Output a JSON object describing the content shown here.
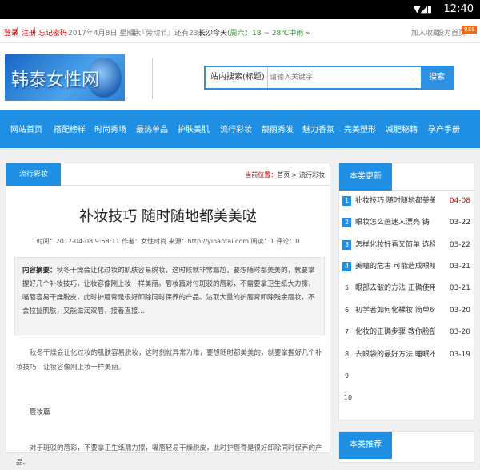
{
  "status_bar": {
    "time": "12:40",
    "signal": "▼◢▮"
  },
  "topbar": {
    "login": "登录",
    "sep1": " / ",
    "register": "注册",
    "sep2": " / ",
    "forgot": "忘记密码",
    "date": "2017年4月8日 星期六",
    "countdown": "距『劳动节』还有23天",
    "city": "长沙",
    "today": "今天",
    "weekday": "(周六)",
    "temp": "：18 ~ 28℃中雨 »",
    "favorite": "加入收藏",
    "homepage": "设为首页",
    "rss": "RSS"
  },
  "header": {
    "logo_text": "韩泰女性网",
    "search_scope": "站内搜索(标题)",
    "search_placeholder": "请输入关键字",
    "search_button": "搜索"
  },
  "nav": [
    "网站首页",
    "搭配榜样",
    "时尚秀场",
    "最热单品",
    "护肤美肌",
    "流行彩妆",
    "靓丽秀发",
    "魅力香氛",
    "完美塑形",
    "减肥秘籍",
    "孕产手册"
  ],
  "article": {
    "tab": "流行彩妆",
    "breadcrumb_label": "当前位置：",
    "breadcrumb_path": "首页 > 流行彩妆",
    "title": "补妆技巧 随时随地都美美哒",
    "meta": "时间：2017-04-08 9:58:11   作者：女性时尚   来源：http://yihantai.com   阅读：1   评论：0",
    "summary_label": "内容摘要：",
    "summary_text": "秋冬干燥会让化过妆的肌肤容易脱妆，这时候就非常尴尬，要想随时都美美的，就要掌握好几个补妆技巧，让妆容像刚上妆一样美丽。唇妆篇对付斑驳的唇彩，不需要拿卫生纸大力擦，嘴唇容易干燥脱皮，此时护唇膏是很好卸除同时保养的产品。沾取大量的护唇膏卸除残余唇妆，不会拉扯肌肤，又能滋润双唇，接着直接...",
    "para1": "秋冬干燥会让化过妆的肌肤容易脱妆，这时刻就异常为难，要想随时都美美的，就要掌握好几个补妆技巧，让妆容像刚上妆一样美丽。",
    "section": "唇妆篇",
    "para2": "对于斑驳的唇彩，不要拿卫生纸鼎力擦，嘴唇轻易干燥脱皮，此时护唇膏是很好卸除同时保养的产品。"
  },
  "sidebar": {
    "title": "本类更新",
    "items": [
      {
        "num": "1",
        "title": "补妆技巧 随时随地都美美",
        "date": "04-08",
        "highlight": true
      },
      {
        "num": "2",
        "title": "眼妆怎么画迷人漂亮 铸",
        "date": "03-22",
        "highlight": false
      },
      {
        "num": "3",
        "title": "怎样化妆好看又简单 选择",
        "date": "03-22",
        "highlight": false
      },
      {
        "num": "4",
        "title": "美瞳的危害 可能造成眼睛",
        "date": "03-21",
        "highlight": false
      },
      {
        "num": "5",
        "title": "眼部去皱的方法 正确使用",
        "date": "03-21",
        "highlight": false
      },
      {
        "num": "6",
        "title": "初学者如何化裸妆 简单6个",
        "date": "03-20",
        "highlight": false
      },
      {
        "num": "7",
        "title": "化妆的正确步骤 教你脸部",
        "date": "03-20",
        "highlight": false
      },
      {
        "num": "8",
        "title": "去眼袋的最好方法 睡眠不",
        "date": "03-19",
        "highlight": false
      },
      {
        "num": "9",
        "title": "",
        "date": "",
        "highlight": false
      },
      {
        "num": "10",
        "title": "",
        "date": "",
        "highlight": false
      }
    ],
    "recommend_title": "本类推荐"
  },
  "colors": {
    "accent": "#1f8fe4",
    "highlight_red": "#d40000",
    "login_red": "#cc0000"
  }
}
